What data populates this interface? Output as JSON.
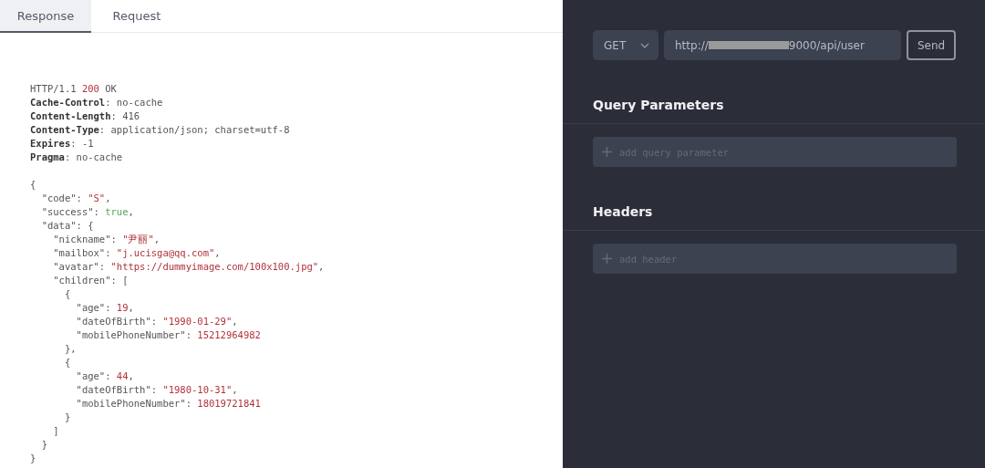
{
  "tabs": [
    {
      "label": "Response",
      "selected": true
    },
    {
      "label": "Request",
      "selected": false
    }
  ],
  "response_lines": [
    {
      "tokens": [
        {
          "kind": "plain",
          "text": "HTTP/1.1 "
        },
        {
          "kind": "number",
          "text": "200"
        },
        {
          "kind": "plain",
          "text": " OK"
        }
      ]
    },
    {
      "tokens": [
        {
          "kind": "header",
          "text": "Cache-Control"
        },
        {
          "kind": "plain",
          "text": ": no-cache"
        }
      ]
    },
    {
      "tokens": [
        {
          "kind": "header",
          "text": "Content-Length"
        },
        {
          "kind": "plain",
          "text": ": 416"
        }
      ]
    },
    {
      "tokens": [
        {
          "kind": "header",
          "text": "Content-Type"
        },
        {
          "kind": "plain",
          "text": ": application/json; charset=utf-8"
        }
      ]
    },
    {
      "tokens": [
        {
          "kind": "header",
          "text": "Expires"
        },
        {
          "kind": "plain",
          "text": ": -1"
        }
      ]
    },
    {
      "tokens": [
        {
          "kind": "header",
          "text": "Pragma"
        },
        {
          "kind": "plain",
          "text": ": no-cache"
        }
      ]
    }
  ],
  "body_lines": [
    {
      "tokens": [
        {
          "kind": "plain",
          "text": "{"
        }
      ]
    },
    {
      "tokens": [
        {
          "kind": "plain",
          "text": "  \"code\": "
        },
        {
          "kind": "string",
          "text": "\"S\""
        },
        {
          "kind": "plain",
          "text": ","
        }
      ]
    },
    {
      "tokens": [
        {
          "kind": "plain",
          "text": "  \"success\": "
        },
        {
          "kind": "bool",
          "text": "true"
        },
        {
          "kind": "plain",
          "text": ","
        }
      ]
    },
    {
      "tokens": [
        {
          "kind": "plain",
          "text": "  \"data\": {"
        }
      ]
    },
    {
      "tokens": [
        {
          "kind": "plain",
          "text": "    \"nickname\": "
        },
        {
          "kind": "string",
          "text": "\"尹丽\""
        },
        {
          "kind": "plain",
          "text": ","
        }
      ]
    },
    {
      "tokens": [
        {
          "kind": "plain",
          "text": "    \"mailbox\": "
        },
        {
          "kind": "string",
          "text": "\"j.ucisga@qq.com\""
        },
        {
          "kind": "plain",
          "text": ","
        }
      ]
    },
    {
      "tokens": [
        {
          "kind": "plain",
          "text": "    \"avatar\": "
        },
        {
          "kind": "string",
          "text": "\"https://dummyimage.com/100x100.jpg\""
        },
        {
          "kind": "plain",
          "text": ","
        }
      ]
    },
    {
      "tokens": [
        {
          "kind": "plain",
          "text": "    \"children\": ["
        }
      ]
    },
    {
      "tokens": [
        {
          "kind": "plain",
          "text": "      {"
        }
      ]
    },
    {
      "tokens": [
        {
          "kind": "plain",
          "text": "        \"age\": "
        },
        {
          "kind": "number",
          "text": "19"
        },
        {
          "kind": "plain",
          "text": ","
        }
      ]
    },
    {
      "tokens": [
        {
          "kind": "plain",
          "text": "        \"dateOfBirth\": "
        },
        {
          "kind": "string",
          "text": "\"1990-01-29\""
        },
        {
          "kind": "plain",
          "text": ","
        }
      ]
    },
    {
      "tokens": [
        {
          "kind": "plain",
          "text": "        \"mobilePhoneNumber\": "
        },
        {
          "kind": "number",
          "text": "15212964982"
        }
      ]
    },
    {
      "tokens": [
        {
          "kind": "plain",
          "text": "      },"
        }
      ]
    },
    {
      "tokens": [
        {
          "kind": "plain",
          "text": "      {"
        }
      ]
    },
    {
      "tokens": [
        {
          "kind": "plain",
          "text": "        \"age\": "
        },
        {
          "kind": "number",
          "text": "44"
        },
        {
          "kind": "plain",
          "text": ","
        }
      ]
    },
    {
      "tokens": [
        {
          "kind": "plain",
          "text": "        \"dateOfBirth\": "
        },
        {
          "kind": "string",
          "text": "\"1980-10-31\""
        },
        {
          "kind": "plain",
          "text": ","
        }
      ]
    },
    {
      "tokens": [
        {
          "kind": "plain",
          "text": "        \"mobilePhoneNumber\": "
        },
        {
          "kind": "number",
          "text": "18019721841"
        }
      ]
    },
    {
      "tokens": [
        {
          "kind": "plain",
          "text": "      }"
        }
      ]
    },
    {
      "tokens": [
        {
          "kind": "plain",
          "text": "    ]"
        }
      ]
    },
    {
      "tokens": [
        {
          "kind": "plain",
          "text": "  }"
        }
      ]
    },
    {
      "tokens": [
        {
          "kind": "plain",
          "text": "}"
        }
      ]
    }
  ],
  "request": {
    "method": "GET",
    "url_start": "http://",
    "url_end": "9000/api/user",
    "send": "Send"
  },
  "sections": [
    {
      "title": "Query Parameters",
      "placeholder": "add query parameter"
    },
    {
      "title": "Headers",
      "placeholder": "add header"
    }
  ]
}
